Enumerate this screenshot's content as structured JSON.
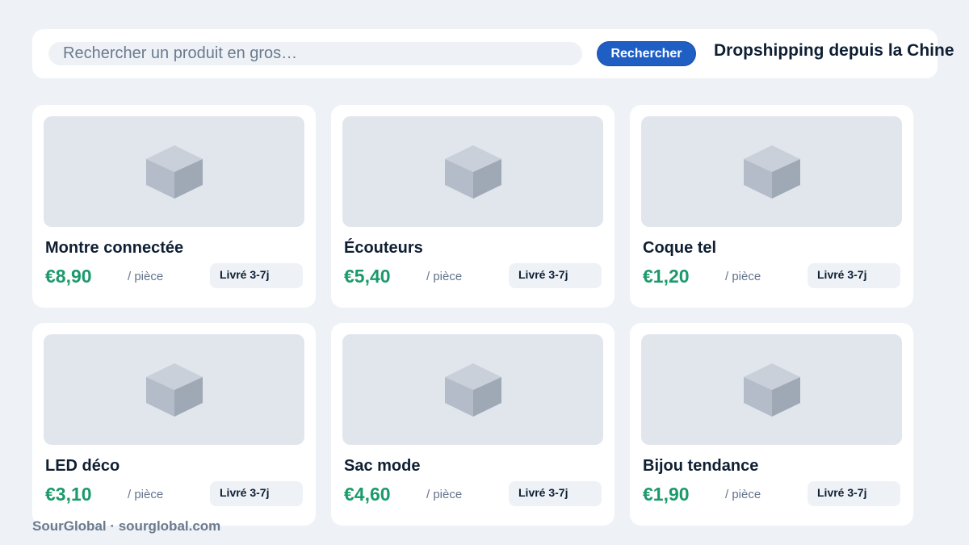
{
  "search": {
    "placeholder": "Rechercher un produit en gros…",
    "button_label": "Rechercher"
  },
  "header": {
    "tagline": "Dropshipping depuis la Chine"
  },
  "products": [
    {
      "name": "Montre connectée",
      "price": "€8,90",
      "unit": "/ pièce",
      "delivery": "Livré 3-7j",
      "image_icon": "box-icon"
    },
    {
      "name": "Écouteurs",
      "price": "€5,40",
      "unit": "/ pièce",
      "delivery": "Livré 3-7j",
      "image_icon": "box-icon"
    },
    {
      "name": "Coque tel",
      "price": "€1,20",
      "unit": "/ pièce",
      "delivery": "Livré 3-7j",
      "image_icon": "box-icon"
    },
    {
      "name": "LED déco",
      "price": "€3,10",
      "unit": "/ pièce",
      "delivery": "Livré 3-7j",
      "image_icon": "box-icon"
    },
    {
      "name": "Sac mode",
      "price": "€4,60",
      "unit": "/ pièce",
      "delivery": "Livré 3-7j",
      "image_icon": "box-icon"
    },
    {
      "name": "Bijou tendance",
      "price": "€1,90",
      "unit": "/ pièce",
      "delivery": "Livré 3-7j",
      "image_icon": "box-icon"
    }
  ],
  "footer": {
    "text": "SourGlobal · sourglobal.com"
  },
  "colors": {
    "background": "#eef2f7",
    "accent": "#1f5fc4",
    "price": "#1c9a6b",
    "text_dark": "#0f1f33",
    "text_muted": "#64748b"
  }
}
